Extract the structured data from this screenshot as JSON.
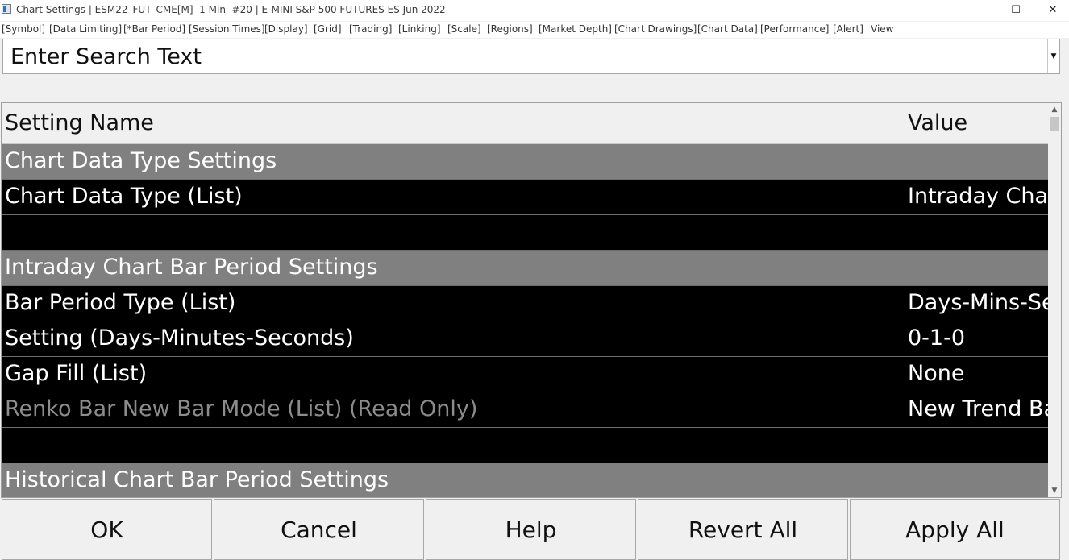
{
  "window": {
    "title": "Chart Settings | ESM22_FUT_CME[M]  1 Min  #20 | E-MINI S&P 500 FUTURES ES Jun 2022",
    "controls": {
      "minimize": "—",
      "maximize": "☐",
      "close": "✕"
    }
  },
  "menu": [
    "[Symbol]",
    "[Data Limiting]",
    "[*Bar Period]",
    "[Session Times]",
    "[Display]",
    "[Grid]",
    "[Trading]",
    "[Linking]",
    "[Scale]",
    "[Regions]",
    "[Market Depth]",
    "[Chart Drawings]",
    "[Chart Data]",
    "[Performance]",
    "[Alert]",
    "View"
  ],
  "search": {
    "placeholder": "Enter Search Text",
    "value": ""
  },
  "grid": {
    "columns": {
      "name": "Setting Name",
      "value": "Value"
    },
    "rows": [
      {
        "type": "group",
        "name": "Chart Data Type Settings",
        "value": ""
      },
      {
        "type": "setting",
        "name": "Chart Data Type (List)",
        "value": "Intraday Chart"
      },
      {
        "type": "empty",
        "name": "",
        "value": ""
      },
      {
        "type": "group",
        "name": "Intraday Chart Bar Period Settings",
        "value": ""
      },
      {
        "type": "setting",
        "name": "Bar Period Type (List)",
        "value": "Days-Mins-Secs"
      },
      {
        "type": "setting",
        "name": "Setting (Days-Minutes-Seconds)",
        "value": "0-1-0"
      },
      {
        "type": "setting",
        "name": "Gap Fill (List)",
        "value": "None"
      },
      {
        "type": "setting readonly",
        "name": "Renko Bar New Bar Mode (List) (Read Only)",
        "value": "New Trend Bar"
      },
      {
        "type": "empty",
        "name": "",
        "value": ""
      },
      {
        "type": "group",
        "name": "Historical Chart Bar Period Settings",
        "value": ""
      }
    ]
  },
  "buttons": {
    "ok": "OK",
    "cancel": "Cancel",
    "help": "Help",
    "revert_all": "Revert All",
    "apply_all": "Apply All"
  },
  "colors": {
    "group_bg": "#808080",
    "row_bg": "#000000",
    "readonly_text": "#8c8c8c"
  }
}
